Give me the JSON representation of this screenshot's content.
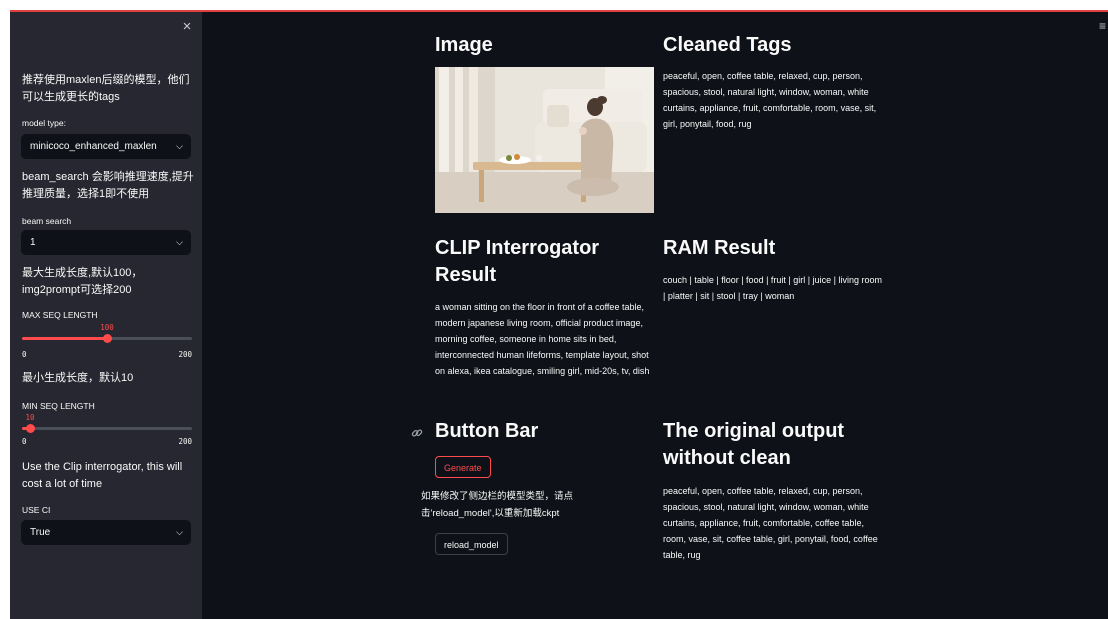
{
  "sidebar": {
    "close_symbol": "×",
    "note_model": "推荐使用maxlen后缀的模型，他们可以生成更长的tags",
    "model_type_label": "model type:",
    "model_type_value": "minicoco_enhanced_maxlen",
    "note_beam": "beam_search 会影响推理速度,提升推理质量，选择1即不使用",
    "beam_label": "beam search",
    "beam_value": "1",
    "note_max": "最大生成长度,默认100，img2prompt可选择200",
    "max_label": "MAX SEQ LENGTH",
    "max_slider": {
      "value": "100",
      "min": "0",
      "max": "200",
      "fraction": 0.5
    },
    "note_min": "最小生成长度，默认10",
    "min_label": "MIN SEQ LENGTH",
    "min_slider": {
      "value": "10",
      "min": "0",
      "max": "200",
      "fraction": 0.05
    },
    "note_ci": "Use the Clip interrogator, this will cost a lot of time",
    "ci_label": "USE CI",
    "ci_value": "True"
  },
  "main": {
    "image_heading": "Image",
    "cleaned_heading": "Cleaned Tags",
    "cleaned_text": "peaceful, open, coffee table, relaxed, cup, person, spacious, stool, natural light, window, woman, white curtains, appliance, fruit, comfortable, room, vase, sit, girl, ponytail, food, rug",
    "clip_heading": "CLIP Interrogator Result",
    "clip_text": "a woman sitting on the floor in front of a coffee table, modern japanese living room, official product image, morning coffee, someone in home sits in bed, interconnected human lifeforms, template layout, shot on alexa, ikea catalogue, smiling girl, mid-20s, tv, dish",
    "ram_heading": "RAM Result",
    "ram_text": "couch | table | floor | food | fruit | girl | juice | living room | platter | sit | stool | tray | woman",
    "button_bar_heading": "Button Bar",
    "generate_label": "Generate",
    "reload_note": "如果修改了侧边栏的模型类型，请点击'reload_model',以重新加载ckpt",
    "reload_label": "reload_model",
    "original_heading": "The original output without clean",
    "original_text": "peaceful, open, coffee table, relaxed, cup, person, spacious, stool, natural light, window, woman, white curtains, appliance, fruit, comfortable, coffee table, room, vase, sit, coffee table, girl, ponytail, food, coffee table, rug"
  },
  "icons": {
    "menu": "hamburger-menu-icon",
    "link": "link-icon",
    "chevron": "chevron-down-icon",
    "close": "close-icon"
  },
  "colors": {
    "background": "#0e1117",
    "sidebar": "#262730",
    "accent": "#ff4b4b"
  }
}
